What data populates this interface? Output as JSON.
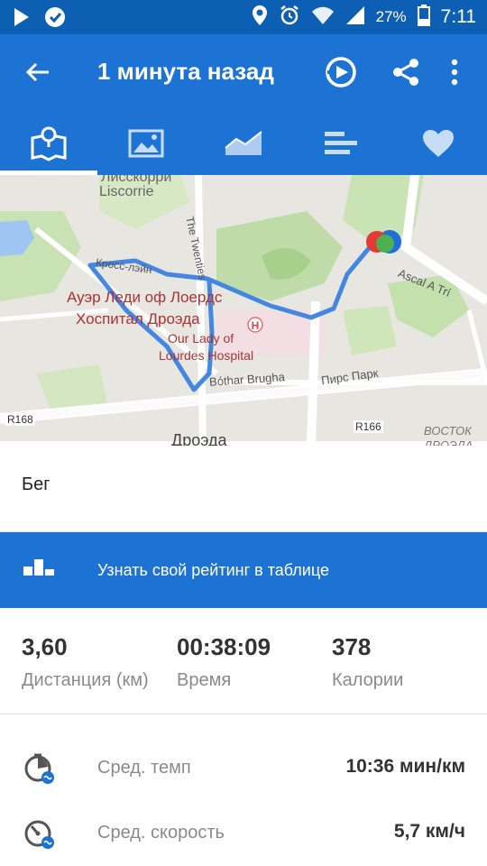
{
  "status_bar": {
    "battery": "27%",
    "time": "7:11"
  },
  "app_bar": {
    "title": "1 минута назад"
  },
  "tabs": [
    {
      "icon": "map-icon",
      "active": true
    },
    {
      "icon": "photo-icon",
      "active": false
    },
    {
      "icon": "chart-icon",
      "active": false
    },
    {
      "icon": "splits-icon",
      "active": false
    },
    {
      "icon": "heart-icon",
      "active": false
    }
  ],
  "map": {
    "labels": {
      "liscorrie_ru": "Лисскорри",
      "liscorrie": "Liscorrie",
      "the_twenties": "The Twenties",
      "cross_lane": "Кросс-лэйн",
      "hospital_ru_1": "Ауэр Леди оф Лоердс",
      "hospital_ru_2": "Хоспитал Дроэда",
      "hospital_en_1": "Our Lady of",
      "hospital_en_2": "Lourdes Hospital",
      "bothar": "Bóthar Brugha",
      "pirs_park": "Пирс Парк",
      "ascal": "Ascal A Trí",
      "r168": "R168",
      "r166": "R166",
      "drogheda": "Дроэда",
      "vostok_1": "ВОСТОК",
      "vostok_2": "ДРОЭДА"
    }
  },
  "activity": {
    "type": "Бег"
  },
  "leaderboard": {
    "label": "Узнать свой рейтинг в таблице"
  },
  "stats": {
    "distance": {
      "value": "3,60",
      "label": "Дистанция (км)"
    },
    "time": {
      "value": "00:38:09",
      "label": "Время"
    },
    "calories": {
      "value": "378",
      "label": "Калории"
    }
  },
  "details": [
    {
      "icon": "pace-icon",
      "label": "Сред. темп",
      "value": "10:36 мин/км"
    },
    {
      "icon": "speed-icon",
      "label": "Сред. скорость",
      "value": "5,7 км/ч"
    }
  ],
  "colors": {
    "status_bar": "#0d5fb3",
    "primary": "#1c73d4",
    "route": "#3b82e0",
    "start_marker": "#4caf50",
    "end_marker": "#e53935"
  }
}
